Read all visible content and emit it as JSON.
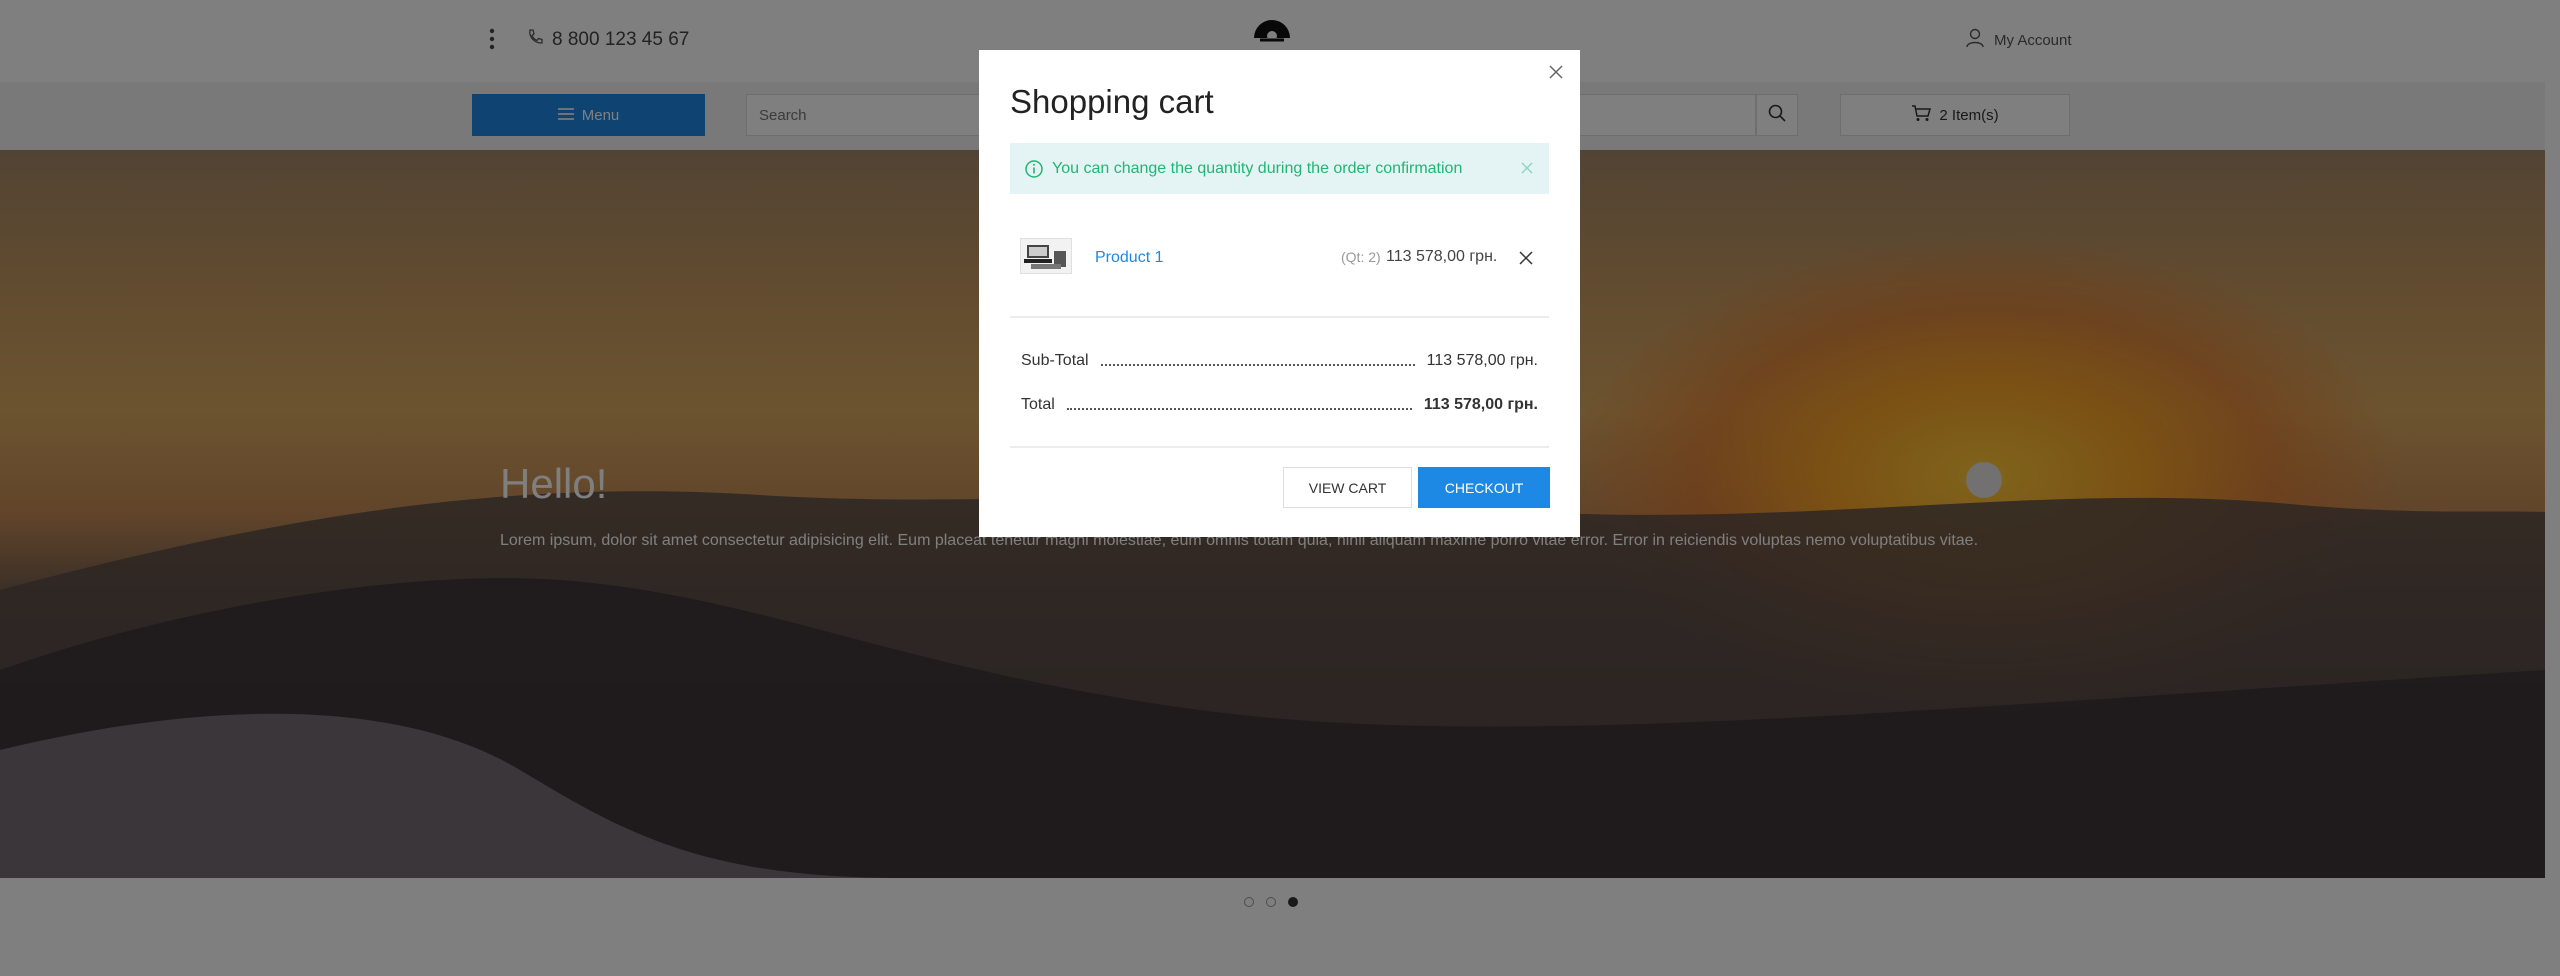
{
  "header": {
    "phone": "8 800 123 45 67",
    "account_label": "My Account"
  },
  "nav": {
    "menu_label": "Menu",
    "search_placeholder": "Search",
    "cart_label": "2 Item(s)"
  },
  "hero": {
    "title": "Hello!",
    "text": "Lorem ipsum, dolor sit amet consectetur adipisicing elit. Eum placeat tenetur magni molestiae, eum omnis totam quia, nihil aliquam maxime porro vitae error. Error in reiciendis voluptas nemo voluptatibus vitae."
  },
  "slider": {
    "total": 3,
    "active": 3
  },
  "modal": {
    "title": "Shopping cart",
    "alert": "You can change the quantity during the order confirmation",
    "item": {
      "name": "Product 1",
      "qty": "(Qt: 2)",
      "price": "113 578,00 грн."
    },
    "subtotal_label": "Sub-Total",
    "subtotal_value": "113 578,00 грн.",
    "total_label": "Total",
    "total_value": "113 578,00 грн.",
    "view_cart_label": "VIEW CART",
    "checkout_label": "CHECKOUT"
  },
  "colors": {
    "accent": "#1e88e5",
    "alert_text": "#22b573",
    "alert_bg": "#e4f4f4"
  },
  "icons": {
    "rail_1": "layout-icon",
    "rail_2": "sliders-icon",
    "menu_dots": "more-vertical-icon",
    "phone": "phone-icon",
    "account": "user-icon",
    "menu": "hamburger-icon",
    "search": "search-icon",
    "cart": "cart-icon",
    "info": "info-icon",
    "close": "close-icon"
  }
}
